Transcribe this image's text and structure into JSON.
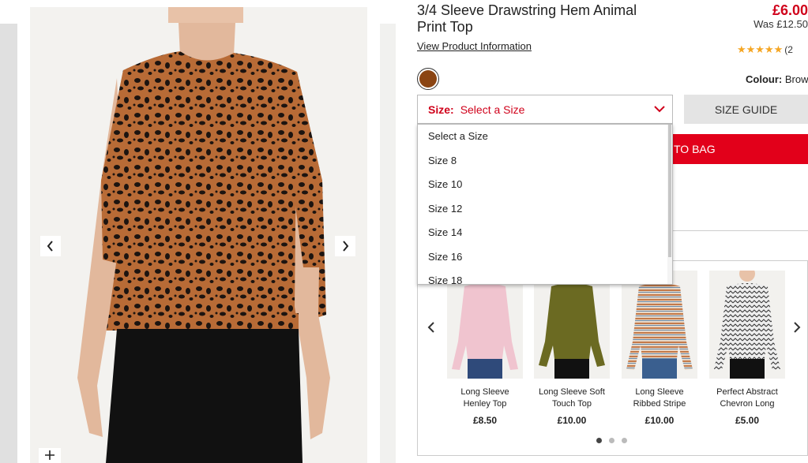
{
  "product": {
    "title": "3/4 Sleeve Drawstring Hem Animal Print Top",
    "price_now": "£6.00",
    "price_was": "Was £12.50",
    "view_info": "View Product Information",
    "rating_count": "(2",
    "rating_stars": "★★★★★",
    "colour_label": "Colour:",
    "colour_value": "Brown",
    "swatch_color": "#8b4513"
  },
  "size": {
    "label": "Size:",
    "selected": "Select a Size",
    "guide": "SIZE GUIDE",
    "options": [
      "Select a Size",
      "Size 8",
      "Size 10",
      "Size 12",
      "Size 14",
      "Size 16",
      "Size 18"
    ]
  },
  "cart": {
    "add_label": "TO BAG"
  },
  "carousel": {
    "items": [
      {
        "name": "Long Sleeve Henley Top",
        "price": "£8.50"
      },
      {
        "name": "Long Sleeve Soft Touch Top",
        "price": "£10.00"
      },
      {
        "name": "Long Sleeve Ribbed Stripe",
        "price": "£10.00"
      },
      {
        "name": "Perfect Abstract Chevron Long",
        "price": "£5.00"
      }
    ]
  },
  "colors": {
    "accent": "#e2001a",
    "price": "#d0021b",
    "star": "#f5a623"
  }
}
